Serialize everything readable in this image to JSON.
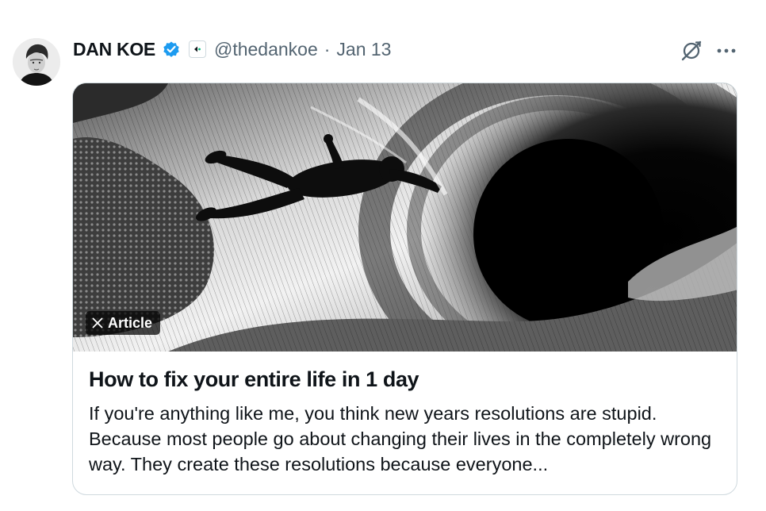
{
  "post": {
    "author": {
      "display_name": "DAN KOE",
      "handle": "@thedankoe",
      "verified": true,
      "avatar_icon": "profile-photo"
    },
    "separator": "·",
    "date": "Jan 13",
    "actions": {
      "grok_icon": "grok-icon",
      "more_icon": "more-horizontal-icon"
    }
  },
  "article": {
    "badge_label": "Article",
    "badge_icon": "x-logo-icon",
    "image_description_icon": "article-cover-image",
    "title": "How to fix your entire life in 1 day",
    "summary": "If you're anything like me, you think new years resolutions are stupid. Because most people go about changing their lives in the completely wrong way. They create these resolutions because everyone..."
  },
  "colors": {
    "text_primary": "#0f1419",
    "text_secondary": "#536471",
    "verified_blue": "#1d9bf0",
    "border": "#cfd9de"
  }
}
